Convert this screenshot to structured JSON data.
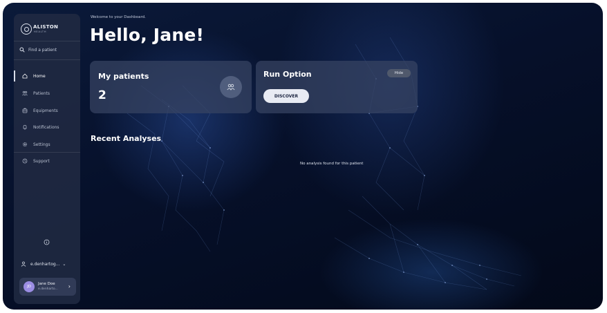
{
  "brand": {
    "name": "ALISTON",
    "sub": "HEALTH"
  },
  "sidebar": {
    "search_label": "Find a patient",
    "items": [
      {
        "label": "Home",
        "icon": "home-icon",
        "active": true
      },
      {
        "label": "Patients",
        "icon": "patients-icon"
      },
      {
        "label": "Equipments",
        "icon": "equipment-icon"
      },
      {
        "label": "Notifications",
        "icon": "bell-icon"
      },
      {
        "label": "Settings",
        "icon": "gear-icon"
      },
      {
        "label": "Support",
        "icon": "support-icon"
      }
    ],
    "account_label": "e.denhartog...",
    "user": {
      "initials": "JD",
      "name": "Jane Doe",
      "email": "e.denharto..."
    }
  },
  "main": {
    "welcome": "Welcome to your Dashboard.",
    "greeting": "Hello, Jane!",
    "patients_card": {
      "title": "My patients",
      "value": "2"
    },
    "run_card": {
      "title": "Run Option",
      "hide_label": "Hide",
      "discover_label": "DISCOVER"
    },
    "recent_title": "Recent Analyses",
    "empty_message": "No analysis found for this patient"
  },
  "colors": {
    "background": "#06102a",
    "panel": "#212a42",
    "avatar": "#9b8de4",
    "button": "#e8ebf3"
  }
}
